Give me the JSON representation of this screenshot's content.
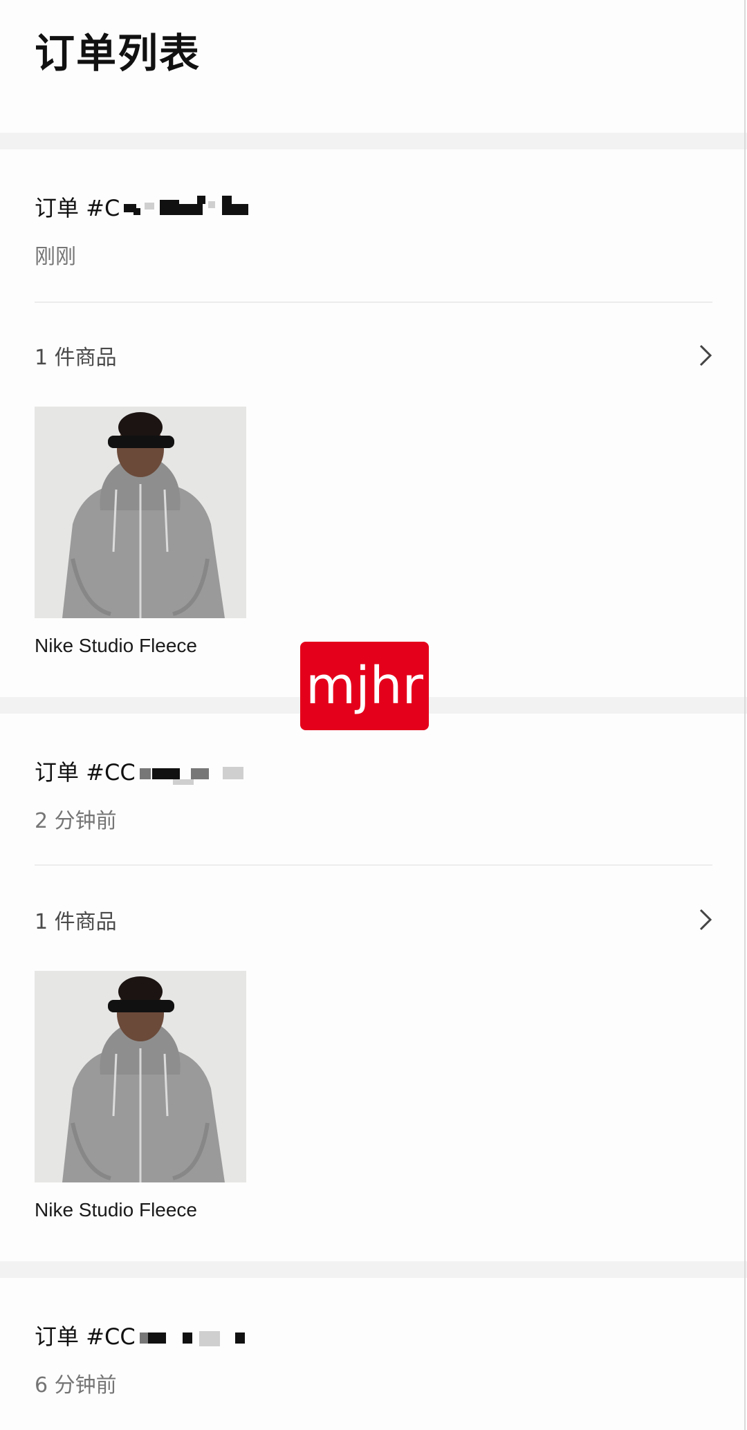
{
  "page": {
    "title": "订单列表"
  },
  "orders": [
    {
      "id_label": "订单 #C",
      "time": "刚刚",
      "items_count": "1 件商品",
      "product": {
        "name": "Nike Studio Fleece"
      }
    },
    {
      "id_label": "订单 #CC",
      "time": "2 分钟前",
      "items_count": "1 件商品",
      "product": {
        "name": "Nike Studio Fleece"
      }
    },
    {
      "id_label": "订单 #CC",
      "time": "6 分钟前"
    }
  ],
  "watermark": {
    "text": "mjhr"
  },
  "colors": {
    "separator": "#f2f2f2",
    "secondary_text": "#757575",
    "watermark_bg": "#e4001b"
  }
}
